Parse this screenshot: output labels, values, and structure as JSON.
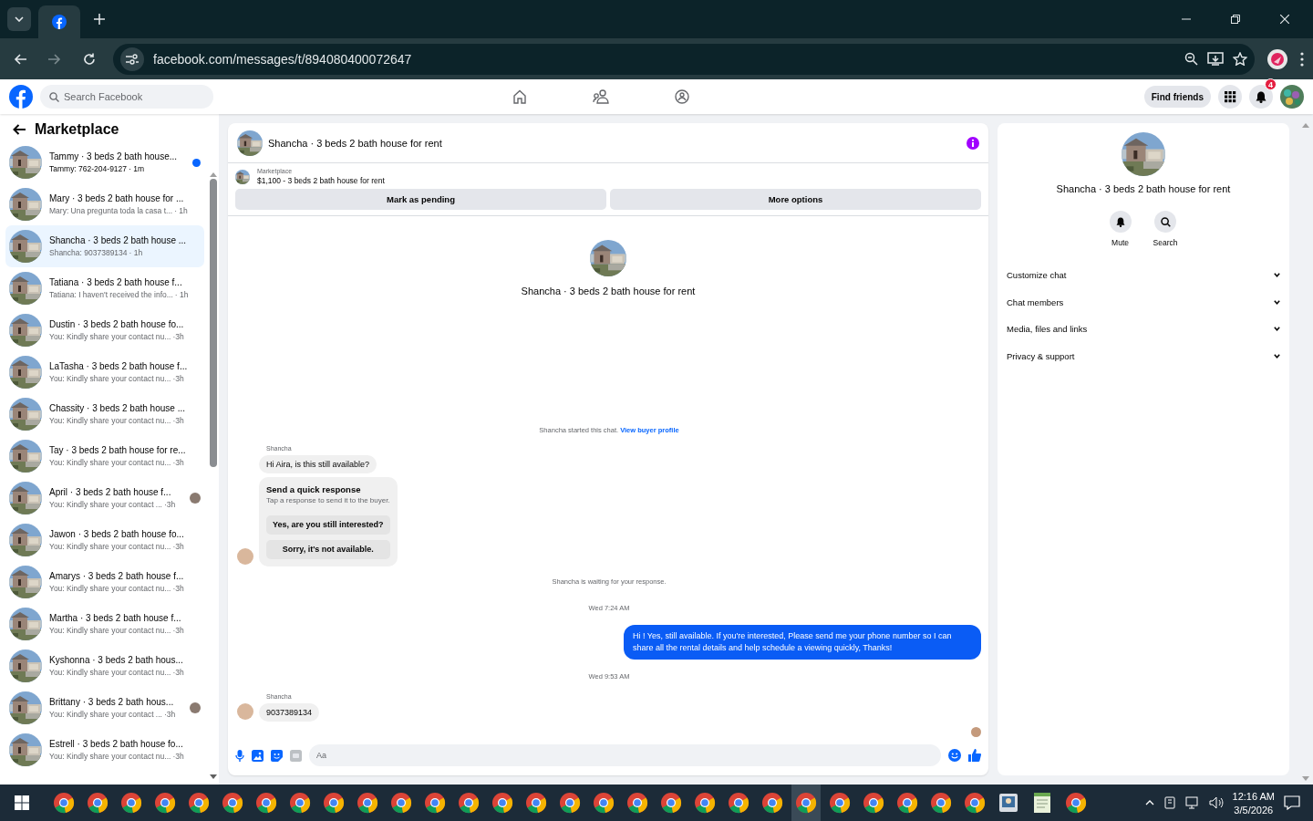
{
  "browser": {
    "address": "facebook.com/messages/t/894080400072647"
  },
  "header": {
    "search_placeholder": "Search Facebook",
    "find_friends": "Find friends",
    "notification_count": "4"
  },
  "sidebar": {
    "title": "Marketplace",
    "conversations": [
      {
        "title": "Tammy · 3 beds 2 bath house...",
        "preview": "Tammy: 762-204-9127",
        "time": "· 1m",
        "selected": false,
        "unread": true,
        "seen_avatar": false
      },
      {
        "title": "Mary · 3 beds 2 bath house for ...",
        "preview": "Mary: Una pregunta toda la casa t...",
        "time": "· 1h",
        "selected": false,
        "unread": false,
        "seen_avatar": false
      },
      {
        "title": "Shancha · 3 beds 2 bath house ...",
        "preview": "Shancha: 9037389134",
        "time": "· 1h",
        "selected": true,
        "unread": false,
        "seen_avatar": false
      },
      {
        "title": "Tatiana · 3 beds 2 bath house f...",
        "preview": "Tatiana: I haven't received the info...",
        "time": "· 1h",
        "selected": false,
        "unread": false,
        "seen_avatar": false
      },
      {
        "title": "Dustin · 3 beds 2 bath house fo...",
        "preview": "You: Kindly share your contact nu...",
        "time": "·3h",
        "selected": false,
        "unread": false,
        "seen_avatar": false
      },
      {
        "title": "LaTasha · 3 beds 2 bath house f...",
        "preview": "You: Kindly share your contact nu...",
        "time": "·3h",
        "selected": false,
        "unread": false,
        "seen_avatar": false
      },
      {
        "title": "Chassity · 3 beds 2 bath house ...",
        "preview": "You: Kindly share your contact nu...",
        "time": "·3h",
        "selected": false,
        "unread": false,
        "seen_avatar": false
      },
      {
        "title": "Tay · 3 beds 2 bath house for re...",
        "preview": "You: Kindly share your contact nu...",
        "time": "·3h",
        "selected": false,
        "unread": false,
        "seen_avatar": false
      },
      {
        "title": "April · 3 beds 2 bath house f...",
        "preview": "You: Kindly share your contact ...",
        "time": "·3h",
        "selected": false,
        "unread": false,
        "seen_avatar": true
      },
      {
        "title": "Jawon · 3 beds 2 bath house fo...",
        "preview": "You: Kindly share your contact nu...",
        "time": "·3h",
        "selected": false,
        "unread": false,
        "seen_avatar": false
      },
      {
        "title": "Amarys · 3 beds 2 bath house f...",
        "preview": "You: Kindly share your contact nu...",
        "time": "·3h",
        "selected": false,
        "unread": false,
        "seen_avatar": false
      },
      {
        "title": "Martha · 3 beds 2 bath house f...",
        "preview": "You: Kindly share your contact nu...",
        "time": "·3h",
        "selected": false,
        "unread": false,
        "seen_avatar": false
      },
      {
        "title": "Kyshonna · 3 beds 2 bath hous...",
        "preview": "You: Kindly share your contact nu...",
        "time": "·3h",
        "selected": false,
        "unread": false,
        "seen_avatar": false
      },
      {
        "title": "Brittany · 3 beds 2 bath hous...",
        "preview": "You: Kindly share your contact ...",
        "time": "·3h",
        "selected": false,
        "unread": false,
        "seen_avatar": true
      },
      {
        "title": "Estrell · 3 beds 2 bath house fo...",
        "preview": "You: Kindly share your contact nu...",
        "time": "·3h",
        "selected": false,
        "unread": false,
        "seen_avatar": false
      }
    ]
  },
  "chat": {
    "title": "Shancha · 3 beds 2 bath house for rent",
    "listing": {
      "label": "Marketplace",
      "text": "$1,100 - 3 beds 2 bath house for rent"
    },
    "actions": [
      "Mark as pending",
      "More options"
    ],
    "intro_title": "Shancha · 3 beds 2 bath house for rent",
    "messages": [
      {
        "kind": "notice",
        "text": "Shancha started this chat.",
        "link": "View buyer profile"
      },
      {
        "kind": "incoming",
        "sender": "Shancha",
        "bubbles": [
          "Hi Aira, is this still available?"
        ],
        "quick_response": {
          "title": "Send a quick response",
          "hint": "Tap a response to send it to the buyer.",
          "options": [
            "Yes, are you still interested?",
            "Sorry, it's not available."
          ]
        }
      },
      {
        "kind": "notice",
        "text": "Shancha is waiting for your response."
      },
      {
        "kind": "timestamp",
        "text": "Wed 7:24 AM"
      },
      {
        "kind": "outgoing",
        "text": "Hi ! Yes, still available. If you're interested, Please send me your phone number so I can share all the rental details and help schedule a viewing quickly, Thanks!"
      },
      {
        "kind": "timestamp",
        "text": "Wed 9:53 AM"
      },
      {
        "kind": "incoming",
        "sender": "Shancha",
        "bubbles": [
          "9037389134"
        ]
      },
      {
        "kind": "seen"
      }
    ],
    "composer_placeholder": "Aa"
  },
  "details": {
    "title": "Shancha · 3 beds 2 bath house for rent",
    "buttons": [
      {
        "kind": "mute",
        "label": "Mute"
      },
      {
        "kind": "search",
        "label": "Search"
      }
    ],
    "sections": [
      "Customize chat",
      "Chat members",
      "Media, files and links",
      "Privacy & support"
    ]
  },
  "taskbar": {
    "apps": [
      {
        "kind": "chrome",
        "selected": false
      },
      {
        "kind": "chrome",
        "selected": false
      },
      {
        "kind": "chrome",
        "selected": false
      },
      {
        "kind": "chrome",
        "selected": false
      },
      {
        "kind": "chrome",
        "selected": false
      },
      {
        "kind": "chrome",
        "selected": false
      },
      {
        "kind": "chrome",
        "selected": false
      },
      {
        "kind": "chrome",
        "selected": false
      },
      {
        "kind": "chrome",
        "selected": false
      },
      {
        "kind": "chrome",
        "selected": false
      },
      {
        "kind": "chrome",
        "selected": false
      },
      {
        "kind": "chrome",
        "selected": false
      },
      {
        "kind": "chrome",
        "selected": false
      },
      {
        "kind": "chrome",
        "selected": false
      },
      {
        "kind": "chrome",
        "selected": false
      },
      {
        "kind": "chrome",
        "selected": false
      },
      {
        "kind": "chrome",
        "selected": false
      },
      {
        "kind": "chrome",
        "selected": false
      },
      {
        "kind": "chrome",
        "selected": false
      },
      {
        "kind": "chrome",
        "selected": false
      },
      {
        "kind": "chrome",
        "selected": false
      },
      {
        "kind": "chrome",
        "selected": false
      },
      {
        "kind": "chrome",
        "selected": true
      },
      {
        "kind": "chrome",
        "selected": false
      },
      {
        "kind": "chrome",
        "selected": false
      },
      {
        "kind": "chrome",
        "selected": false
      },
      {
        "kind": "chrome",
        "selected": false
      },
      {
        "kind": "chrome",
        "selected": false
      },
      {
        "kind": "viewer",
        "selected": false
      },
      {
        "kind": "notepad",
        "selected": false
      },
      {
        "kind": "chrome",
        "selected": false
      }
    ],
    "time": "12:16 AM",
    "date": "3/5/2026"
  }
}
